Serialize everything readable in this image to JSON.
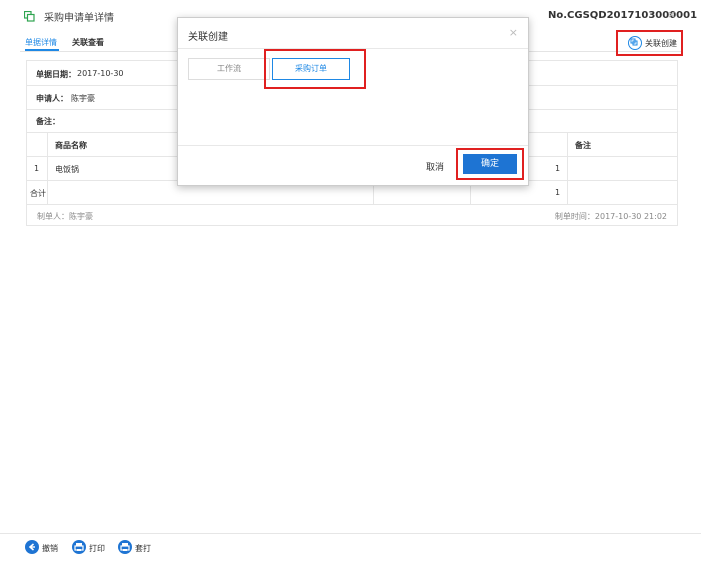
{
  "header": {
    "title": "采购申请单详情",
    "doc_no": "No.CGSQD2017103000001",
    "close": "×",
    "tabs": [
      {
        "label": "单据详情"
      },
      {
        "label": "关联查看"
      }
    ],
    "relate_button": "关联创建"
  },
  "form": {
    "date_label": "单据日期：",
    "date_value": "2017-10-30",
    "applicant_label": "申请人：",
    "applicant_value": "陈宇豪",
    "remark_label": "备注：",
    "table": {
      "headers": [
        "商品名称",
        "备注"
      ],
      "rows": [
        {
          "no": "1",
          "name": "电饭锅",
          "qty": "1"
        }
      ],
      "total_label": "合计",
      "total_qty": "1"
    },
    "maker_label": "制单人：陈宇豪",
    "made_time": "制单时间：2017-10-30 21:02"
  },
  "dialog": {
    "title": "关联创建",
    "close": "×",
    "options": [
      {
        "label": "工作流"
      },
      {
        "label": "采购订单"
      }
    ],
    "cancel": "取消",
    "ok": "确定"
  },
  "footer": {
    "buttons": [
      {
        "label": "撤销"
      },
      {
        "label": "打印"
      },
      {
        "label": "套打"
      }
    ]
  },
  "colors": {
    "accent": "#1e88e5",
    "primary_button": "#1e74d3",
    "highlight": "#e02020"
  }
}
